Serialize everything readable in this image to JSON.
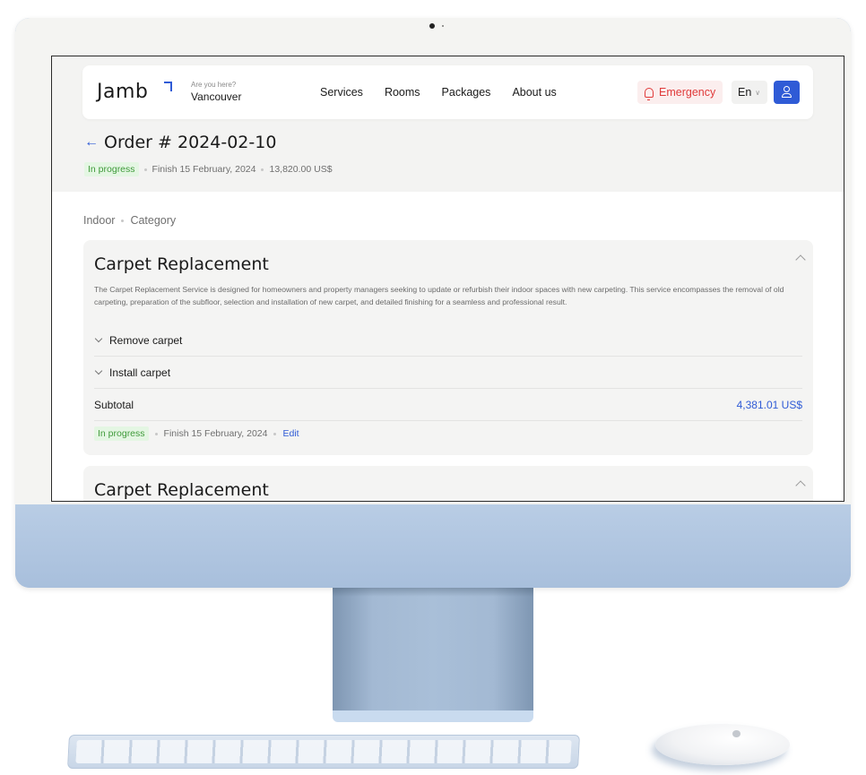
{
  "header": {
    "logo": "Jamb",
    "location_question": "Are you here?",
    "location_city": "Vancouver",
    "nav": [
      "Services",
      "Rooms",
      "Packages",
      "About us"
    ],
    "emergency_label": "Emergency",
    "language": "En"
  },
  "order": {
    "title": "Order # 2024-02-10",
    "status": "In progress",
    "finish": "Finish 15 February, 2024",
    "total": "13,820.00 US$"
  },
  "breadcrumb": [
    "Indoor",
    "Category"
  ],
  "cards": [
    {
      "title": "Carpet Replacement",
      "description": "The Carpet Replacement Service is designed for homeowners and property managers seeking to update or refurbish their indoor spaces with new carpeting. This service encompasses the removal of old carpeting, preparation of the subfloor, selection and installation of new carpet, and detailed finishing for a seamless and professional result.",
      "items": [
        "Remove carpet",
        "Install carpet"
      ],
      "subtotal_label": "Subtotal",
      "subtotal_value": "4,381.01 US$",
      "status": "In progress",
      "finish": "Finish 15 February, 2024",
      "edit_label": "Edit"
    },
    {
      "title": "Carpet Replacement"
    }
  ],
  "colors": {
    "accent": "#2f5bd6",
    "emergency": "#e03a3a",
    "status_green": "#3f9a3a",
    "device_blue": "#b3c8e2"
  }
}
